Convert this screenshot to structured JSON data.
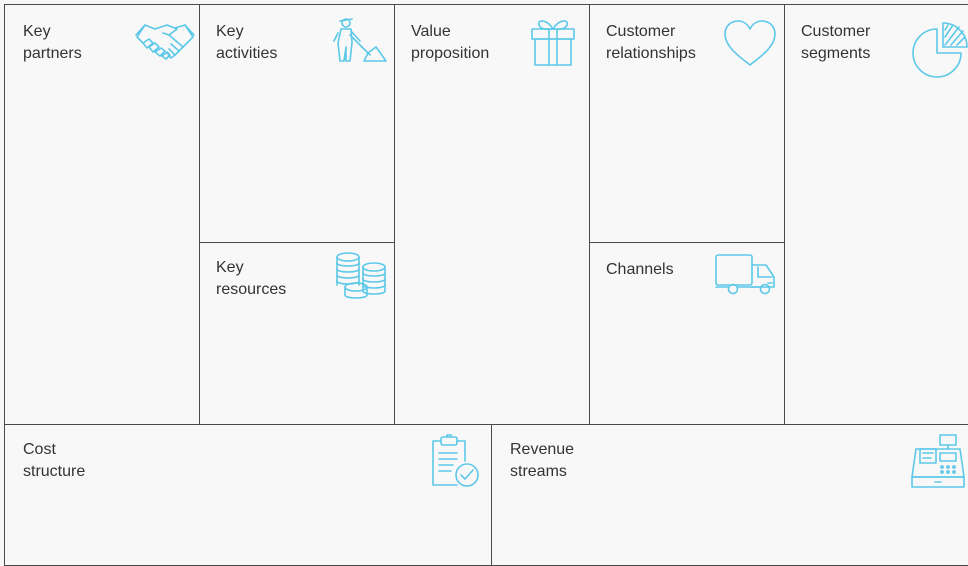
{
  "accent_color": "#5cc8e8",
  "line_color": "#4a4a4a",
  "background_color": "#f8f8f8",
  "blocks": {
    "key_partners": {
      "label": "Key\npartners",
      "icon": "handshake-icon"
    },
    "key_activities": {
      "label": "Key\nactivities",
      "icon": "worker-shovel-icon"
    },
    "key_resources": {
      "label": "Key\nresources",
      "icon": "coin-stacks-icon"
    },
    "value_proposition": {
      "label": "Value\nproposition",
      "icon": "gift-icon"
    },
    "customer_relationships": {
      "label": "Customer\nrelationships",
      "icon": "heart-icon"
    },
    "channels": {
      "label": "Channels",
      "icon": "truck-icon"
    },
    "customer_segments": {
      "label": "Customer\nsegments",
      "icon": "pie-chart-icon"
    },
    "cost_structure": {
      "label": "Cost\nstructure",
      "icon": "clipboard-check-icon"
    },
    "revenue_streams": {
      "label": "Revenue\nstreams",
      "icon": "cash-register-icon"
    }
  }
}
